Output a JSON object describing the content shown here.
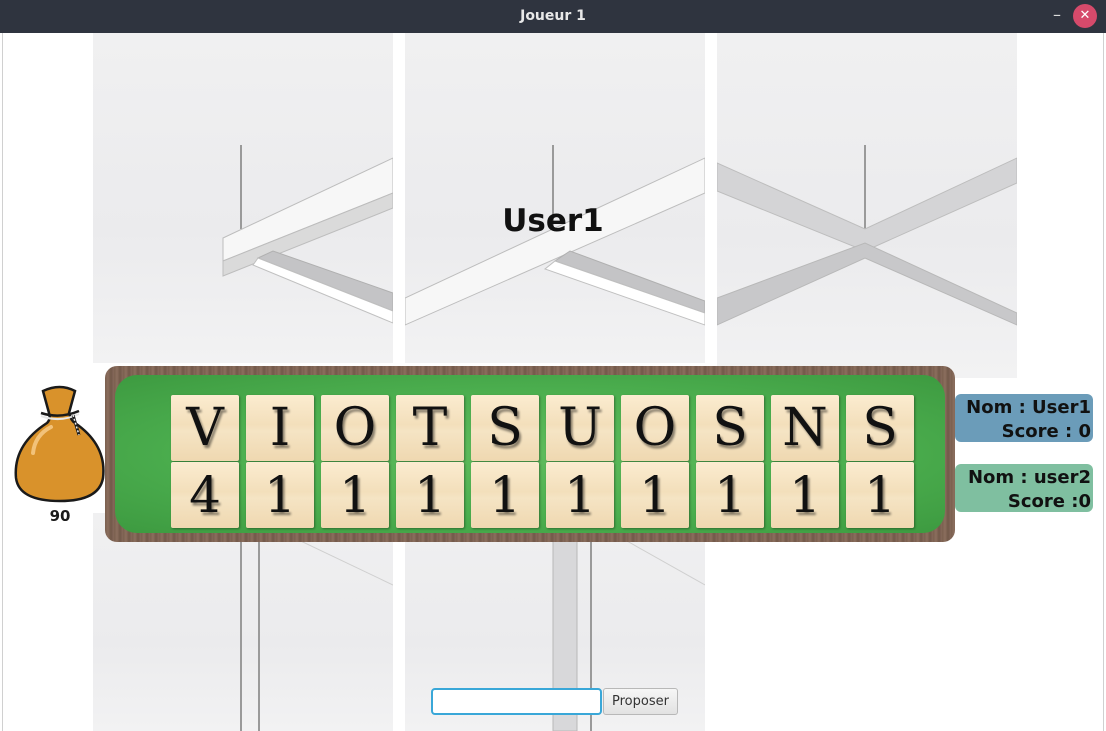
{
  "window": {
    "title": "Joueur 1",
    "minimize_glyph": "–",
    "close_glyph": "✕"
  },
  "player": {
    "name": "User1"
  },
  "bag": {
    "remaining": "90",
    "icon": "bag-icon"
  },
  "board": {
    "letters": [
      "V",
      "I",
      "O",
      "T",
      "S",
      "U",
      "O",
      "S",
      "N",
      "S"
    ],
    "scores": [
      "4",
      "1",
      "1",
      "1",
      "1",
      "1",
      "1",
      "1",
      "1",
      "1"
    ]
  },
  "players": [
    {
      "name_line": "Nom : User1",
      "score_line": "Score : 0"
    },
    {
      "name_line": "Nom : user2",
      "score_line": "Score :0"
    }
  ],
  "input": {
    "value": "",
    "placeholder": ""
  },
  "propose_label": "Proposer",
  "colors": {
    "felt": "#4caf4f",
    "tile": "#f3dfbb",
    "player1_card": "#6b9cb9",
    "player2_card": "#7fbfa0",
    "titlebar": "#2f343f",
    "close": "#d64a6b"
  }
}
